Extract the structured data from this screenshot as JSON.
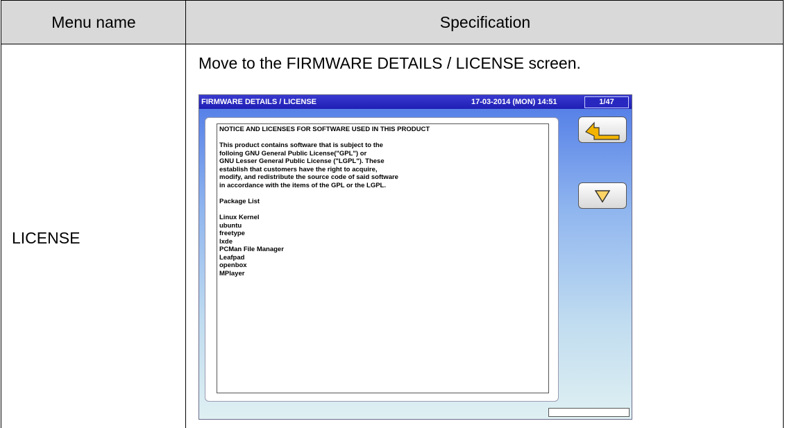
{
  "table": {
    "header_menu": "Menu name",
    "header_spec": "Specification",
    "row_menu": "LICENSE",
    "row_spec": "Move to the FIRMWARE DETAILS / LICENSE screen."
  },
  "screen": {
    "title": "FIRMWARE DETAILS / LICENSE",
    "datetime": "17-03-2014 (MON)  14:51",
    "page": "1/47",
    "lines": [
      "NOTICE AND LICENSES FOR SOFTWARE USED IN THIS PRODUCT",
      "",
      "This product contains software that is subject to the",
      "folloing GNU General Public License(\"GPL\") or",
      "GNU Lesser General Public License (\"LGPL\"). These",
      "establish that customers have the right to acquire,",
      "modify, and redistribute the source code of said software",
      "in accordance with the items of the GPL or the LGPL.",
      "",
      "Package List",
      "",
      "Linux Kernel",
      "ubuntu",
      "freetype",
      "lxde",
      "PCMan File Manager",
      "Leafpad",
      "openbox",
      "MPlayer"
    ],
    "back_icon": "return-arrow-icon",
    "down_icon": "triangle-down-icon",
    "accent_title": "#2323b8",
    "accent_icon": "#f0a000"
  }
}
